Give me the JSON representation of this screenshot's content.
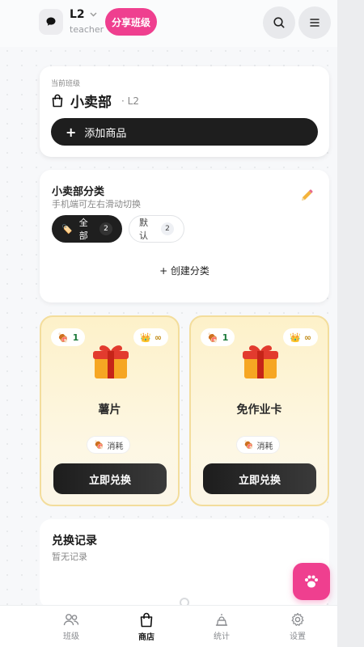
{
  "header": {
    "level": "L2",
    "role": "teacher",
    "share_label": "分享班级"
  },
  "current_class": {
    "label": "当前班级",
    "name": "小卖部",
    "level": "· L2",
    "add_label": "添加商品"
  },
  "categories": {
    "title": "小卖部分类",
    "subtitle": "手机端可左右滑动切换",
    "chips": [
      {
        "label": "全部",
        "count": "2",
        "active": true
      },
      {
        "label": "默认",
        "count": "2",
        "active": false
      }
    ],
    "create_label": "+ 创建分类"
  },
  "products": [
    {
      "name": "薯片",
      "cost": "1",
      "stock": "∞",
      "type": "消耗",
      "redeem_label": "立即兑换"
    },
    {
      "name": "免作业卡",
      "cost": "1",
      "stock": "∞",
      "type": "消耗",
      "redeem_label": "立即兑换"
    }
  ],
  "records": {
    "title": "兑换记录",
    "empty": "暂无记录"
  },
  "nav": [
    {
      "label": "班级",
      "icon": "users-icon",
      "active": false
    },
    {
      "label": "商店",
      "icon": "shopping-bag-icon",
      "active": true
    },
    {
      "label": "统计",
      "icon": "podium-icon",
      "active": false
    },
    {
      "label": "设置",
      "icon": "gear-icon",
      "active": false
    }
  ],
  "colors": {
    "accent": "#ef3f8f",
    "dark_button": "#1e1e1e",
    "card_gold_border": "#f3dd9c"
  }
}
